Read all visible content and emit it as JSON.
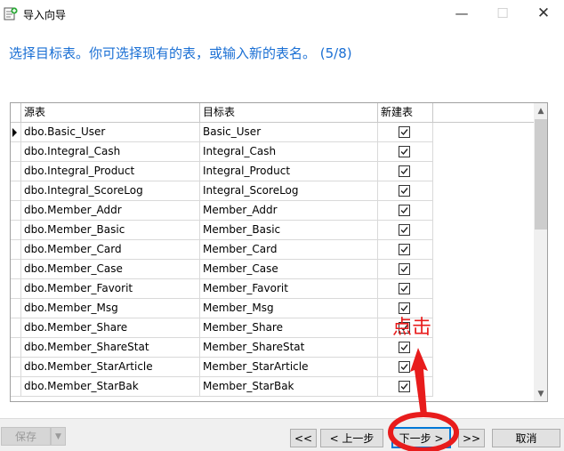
{
  "window": {
    "title": "导入向导"
  },
  "heading": "选择目标表。你可选择现有的表，或输入新的表名。 (5/8)",
  "grid": {
    "headers": [
      "源表",
      "目标表",
      "新建表"
    ],
    "rows": [
      {
        "source": "dbo.Basic_User",
        "target": "Basic_User",
        "new_table": true,
        "current": true
      },
      {
        "source": "dbo.Integral_Cash",
        "target": "Integral_Cash",
        "new_table": true
      },
      {
        "source": "dbo.Integral_Product",
        "target": "Integral_Product",
        "new_table": true
      },
      {
        "source": "dbo.Integral_ScoreLog",
        "target": "Integral_ScoreLog",
        "new_table": true
      },
      {
        "source": "dbo.Member_Addr",
        "target": "Member_Addr",
        "new_table": true
      },
      {
        "source": "dbo.Member_Basic",
        "target": "Member_Basic",
        "new_table": true
      },
      {
        "source": "dbo.Member_Card",
        "target": "Member_Card",
        "new_table": true
      },
      {
        "source": "dbo.Member_Case",
        "target": "Member_Case",
        "new_table": true
      },
      {
        "source": "dbo.Member_Favorit",
        "target": "Member_Favorit",
        "new_table": true
      },
      {
        "source": "dbo.Member_Msg",
        "target": "Member_Msg",
        "new_table": true
      },
      {
        "source": "dbo.Member_Share",
        "target": "Member_Share",
        "new_table": true
      },
      {
        "source": "dbo.Member_ShareStat",
        "target": "Member_ShareStat",
        "new_table": true
      },
      {
        "source": "dbo.Member_StarArticle",
        "target": "Member_StarArticle",
        "new_table": true
      },
      {
        "source": "dbo.Member_StarBak",
        "target": "Member_StarBak",
        "new_table": true
      }
    ]
  },
  "buttons": {
    "save": "保存",
    "first": "<<",
    "prev": "< 上一步",
    "next": "下一步 >",
    "last": ">>",
    "cancel": "取消"
  },
  "annotation": {
    "text": "点击",
    "color": "#e81c1c"
  },
  "colors": {
    "heading": "#1a6fd4",
    "accent": "#0078d7"
  }
}
